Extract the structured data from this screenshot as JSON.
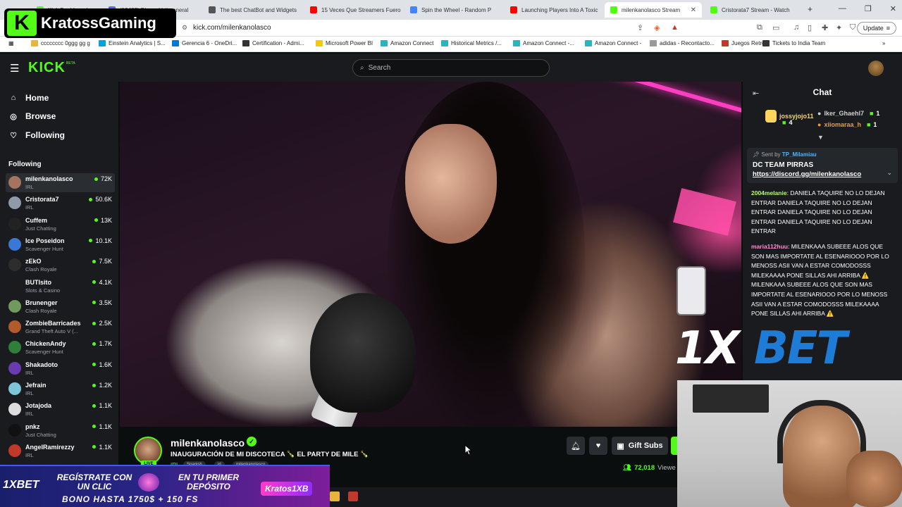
{
  "browser": {
    "tabs": [
      {
        "label": "Kick Dashboard",
        "color": "#53fc18"
      },
      {
        "label": "(10483) Discord | #-general",
        "color": "#5865f2"
      },
      {
        "label": "The best ChatBot and Widgets",
        "color": "#555555"
      },
      {
        "label": "15 Veces Que Streamers Fuero",
        "color": "#ff0000"
      },
      {
        "label": "Spin the Wheel - Random P",
        "color": "#4285f4"
      },
      {
        "label": "Launching Players Into A Toxic",
        "color": "#ff0000"
      },
      {
        "label": "milenkanolasco Stream",
        "color": "#53fc18"
      },
      {
        "label": "Cristorata7 Stream - Watch",
        "color": "#53fc18"
      }
    ],
    "url": "kick.com/milenkanolasco",
    "update_label": "Update",
    "bookmarks": [
      "cccccccc 0ggg gg g",
      "Einstein Analytics | S...",
      "Gerencia 6 - OneDri...",
      "Certification - Admi...",
      "Microsoft Power BI",
      "Amazon Connect",
      "Historical Metrics /...",
      "Amazon Connect -...",
      "Amazon Connect -",
      "adidas - Recontacto...",
      "Juegos Retro",
      "Tickets to India Team"
    ]
  },
  "brand_overlay": {
    "letter": "K",
    "name": "KratossGaming"
  },
  "kick": {
    "logo": "KICK",
    "beta": "BETA",
    "search_placeholder": "Search"
  },
  "sidebar": {
    "nav": [
      {
        "label": "Home",
        "icon": "home-icon"
      },
      {
        "label": "Browse",
        "icon": "compass-icon"
      },
      {
        "label": "Following",
        "icon": "heart-icon"
      }
    ],
    "following_header": "Following",
    "channels": [
      {
        "name": "milenkanolasco",
        "category": "IRL",
        "viewers": "72K",
        "color": "#a57460"
      },
      {
        "name": "Cristorata7",
        "category": "IRL",
        "viewers": "50.6K",
        "color": "#8d9aa8"
      },
      {
        "name": "Cuffem",
        "category": "Just Chatting",
        "viewers": "13K",
        "color": "#222222"
      },
      {
        "name": "Ice Poseidon",
        "category": "Scavenger Hunt",
        "viewers": "10.1K",
        "color": "#3a78d8"
      },
      {
        "name": "zEkO",
        "category": "Clash Royale",
        "viewers": "7.5K",
        "color": "#2d2d2d"
      },
      {
        "name": "BUTIsito",
        "category": "Slots & Casino",
        "viewers": "4.1K",
        "color": "#1b1b1b"
      },
      {
        "name": "Brunenger",
        "category": "Clash Royale",
        "viewers": "3.5K",
        "color": "#6f9a5b"
      },
      {
        "name": "ZombieBarricades",
        "category": "Grand Theft Auto V (...",
        "viewers": "2.5K",
        "color": "#b25a2c"
      },
      {
        "name": "ChickenAndy",
        "category": "Scavenger Hunt",
        "viewers": "1.7K",
        "color": "#2f7f3a"
      },
      {
        "name": "Shakadoto",
        "category": "IRL",
        "viewers": "1.6K",
        "color": "#6a3ab0"
      },
      {
        "name": "Jefrain",
        "category": "IRL",
        "viewers": "1.2K",
        "color": "#7dc6d8"
      },
      {
        "name": "Jotajoda",
        "category": "IRL",
        "viewers": "1.1K",
        "color": "#dddddd"
      },
      {
        "name": "pnkz",
        "category": "Just Chatting",
        "viewers": "1.1K",
        "color": "#111111"
      },
      {
        "name": "AngelRamirezzy",
        "category": "IRL",
        "viewers": "1.1K",
        "color": "#c0392b"
      }
    ]
  },
  "stream": {
    "streamer": "milenkanolasco",
    "live_label": "LIVE",
    "title": "INAUGURACIÓN DE MI DISCOTECA 🍾 EL PARTY DE MILE 🍾",
    "category": "IRL",
    "tags": [
      "Spanish",
      "irl",
      "milenkanolasco"
    ],
    "gift_label": "Gift Subs",
    "viewers": "72,018",
    "viewers_label": "Viewe"
  },
  "chat": {
    "title": "Chat",
    "top_gifters": [
      {
        "name": "jossyjojo11",
        "count": "4",
        "color": "#ffd45c"
      },
      {
        "name": "Iker_Ghaehl7",
        "count": "1",
        "color": "#cfcfcf"
      },
      {
        "name": "xiiomaraa_h",
        "count": "1",
        "color": "#e89b3a"
      }
    ],
    "pinned": {
      "sent_by": "Sent by",
      "user": "TP_Milamiau",
      "text": "DC TEAM PIRRAS",
      "link": "https://discord.gg/milenkanolasco"
    },
    "messages": [
      {
        "user": "2004melanie",
        "color": "#b6ff6a",
        "text": "DANIELA TAQUIRE NO LO DEJAN ENTRAR DANIELA TAQUIRE NO LO DEJAN ENTRAR DANIELA TAQUIRE NO LO DEJAN ENTRAR DANIELA TAQUIRE NO LO DEJAN ENTRAR"
      },
      {
        "user": "maria112huu",
        "color": "#ff8fd1",
        "text": "MILENKAAA SUBEEE ALOS QUE SON MAS IMPORTATE AL ESENARIOOO POR LO MENOSS ASII VAN A ESTAR COMODOSSS MILEKAAAA PONE SILLAS AHI ARRIBA ⚠️ MILENKAAA SUBEEE ALOS QUE SON MAS IMPORTATE AL ESENARIOOO POR LO MENOSS ASII VAN A ESTAR COMODOSSS MILEKAAAA PONE SILLAS AHI ARRIBA ⚠️"
      }
    ]
  },
  "overlays": {
    "sponsor_1x": "1X",
    "sponsor_bet": "BET",
    "promo_logo": "1XBET",
    "promo_line1": "REGÍSTRATE CON UN CLIC",
    "promo_line2": "EN TU PRIMER DEPÓSITO",
    "promo_bonus": "BONO HASTA 1750$ + 150 FS",
    "promo_code": "Kratos1XB"
  },
  "colors": {
    "accent": "#53fc18",
    "bg": "#0b0e0f",
    "panel": "#191b1f"
  }
}
